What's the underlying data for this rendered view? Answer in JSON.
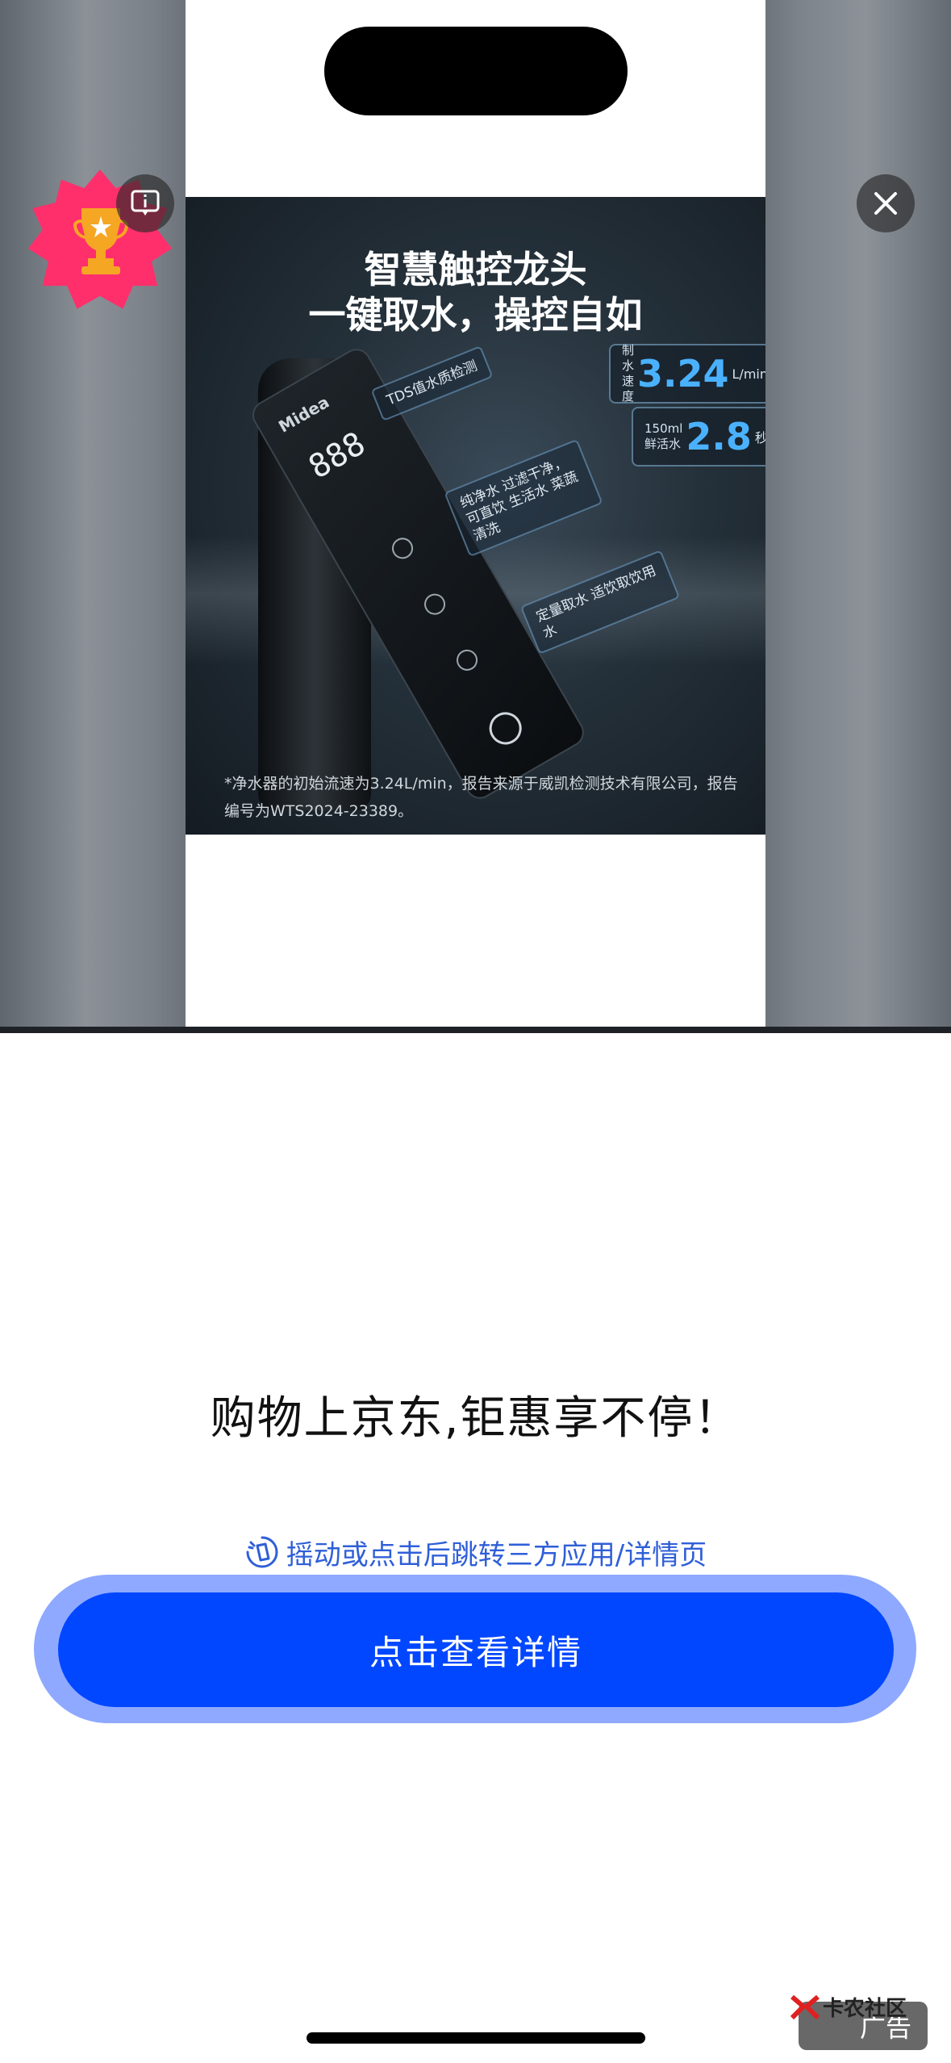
{
  "ad_image": {
    "headline_line1": "智慧触控龙头",
    "headline_line2": "一键取水，操控自如",
    "brand": "Midea",
    "display_digits": "888",
    "spec_speed_label": "制水速度",
    "spec_speed_value": "3.24",
    "spec_speed_unit": "L/min",
    "spec_time_label": "150ml 鲜活水",
    "spec_time_value": "2.8",
    "spec_time_unit": "秒",
    "callout_tds": "TDS值水质检测",
    "callout_mode": "纯净水 过滤干净，可直饮 生活水 菜蔬清洗",
    "callout_qty": "定量取水 适饮取饮用水",
    "footnote": "*净水器的初始流速为3.24L/min，报告来源于威凯检测技术有限公司，报告编号为WTS2024-23389。"
  },
  "slogan": "购物上京东,钜惠享不停！",
  "hint": "摇动或点击后跳转三方应用/详情页",
  "cta_label": "点击查看详情",
  "ad_label": "广告",
  "watermark": "卡农社区",
  "colors": {
    "cta": "#0047ff",
    "cta_halo": "#8ea9ff",
    "hint": "#2f5fd8",
    "badge": "#ff2f6c"
  }
}
